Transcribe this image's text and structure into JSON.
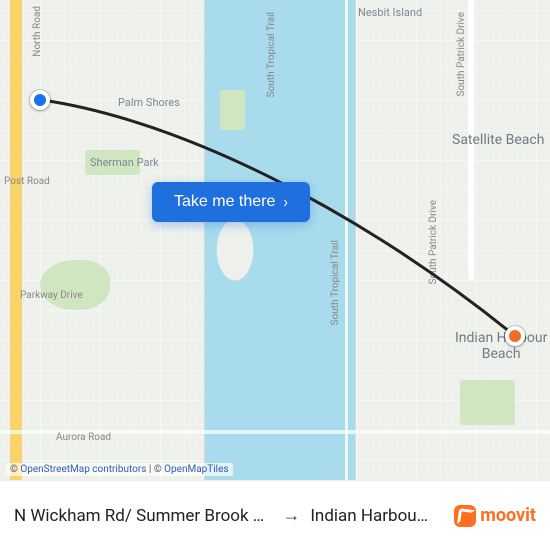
{
  "map": {
    "places": {
      "palm_shores": "Palm Shores",
      "nesbit_island": "Nesbit Island",
      "satellite_beach": "Satellite Beach",
      "indian_harbour_beach": "Indian Harbour\nBeach",
      "sherman_park": "Sherman Park"
    },
    "roads": {
      "north_road_w": "North Road",
      "post_road": "Post Road",
      "parkway_drive": "Parkway Drive",
      "aurora_road": "Aurora Road",
      "s_tropical_trail_1": "South Tropical Trail",
      "s_tropical_trail_2": "South Tropical Trail",
      "s_patrick_drive_1": "South Patrick Drive",
      "s_patrick_drive_2": "South Patrick Drive"
    },
    "cta_label": "Take me there",
    "cta_chevron": "›",
    "attribution_prefix": "© ",
    "attribution_osm": "OpenStreetMap contributors",
    "attribution_sep": " | © ",
    "attribution_tiles": "OpenMapTiles",
    "origin": {
      "name": "N Wickham Rd/ Summer Brook S…",
      "color": "#1a73e8"
    },
    "destination": {
      "name": "Indian Harbou…",
      "color": "#f26a2a"
    }
  },
  "route_bar": {
    "from": "N Wickham Rd/ Summer Brook S…",
    "arrow_icon": "→",
    "to": "Indian Harbou…",
    "brand": "moovit"
  }
}
